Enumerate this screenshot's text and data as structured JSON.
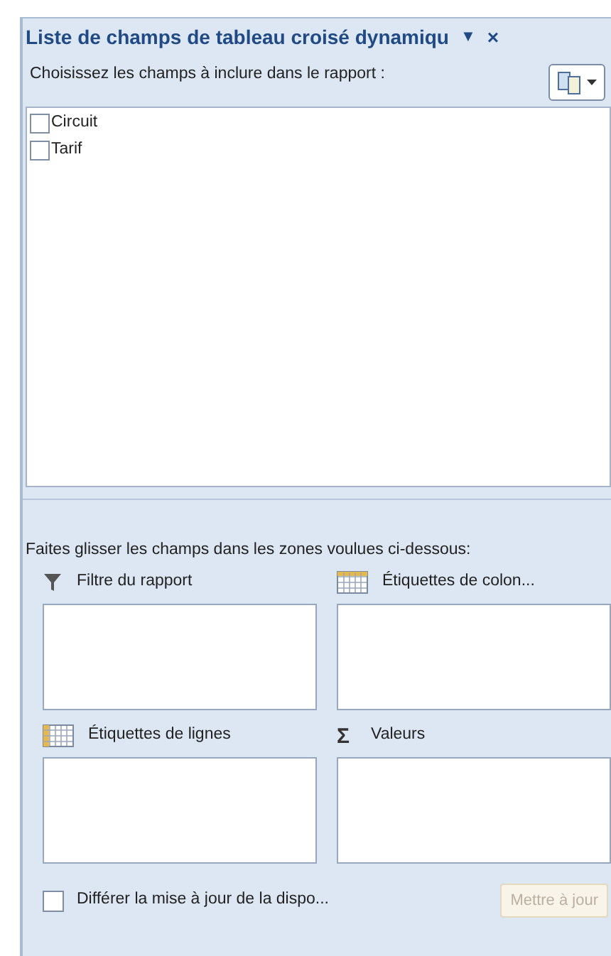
{
  "panel": {
    "title": "Liste de champs de tableau croisé dynamiqu",
    "menu_glyph": "▼",
    "close_glyph": "×"
  },
  "fields_prompt": "Choisissez les champs à inclure dans le rapport :",
  "fields": [
    {
      "label": "Circuit",
      "checked": false
    },
    {
      "label": "Tarif",
      "checked": false
    }
  ],
  "zones_prompt": "Faites glisser les champs dans les zones voulues ci-dessous:",
  "zones": [
    {
      "kind": "filter",
      "label": "Filtre du rapport"
    },
    {
      "kind": "columns",
      "label": "Étiquettes de colon..."
    },
    {
      "kind": "rows",
      "label": "Étiquettes de lignes"
    },
    {
      "kind": "values",
      "label": "Valeurs",
      "glyph": "Σ"
    }
  ],
  "defer": {
    "label": "Différer la mise à jour de la dispo...",
    "checked": false
  },
  "update_button": {
    "label": "Mettre à jour",
    "disabled": true
  }
}
